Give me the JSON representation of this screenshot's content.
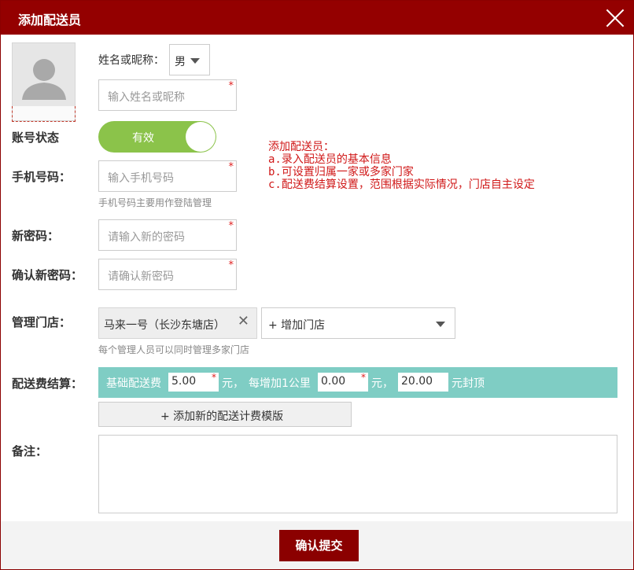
{
  "dialog": {
    "title": "添加配送员"
  },
  "form": {
    "name_label": "姓名或昵称：",
    "gender_value": "男",
    "name_placeholder": "输入姓名或昵称",
    "required_mark": "*",
    "status_label": "账号状态",
    "status_value": "有效",
    "phone_label": "手机号码：",
    "phone_placeholder": "输入手机号码",
    "phone_hint": "手机号码主要用作登陆管理",
    "new_password_label": "新密码：",
    "new_password_placeholder": "请输入新的密码",
    "confirm_password_label": "确认新密码：",
    "confirm_password_placeholder": "请确认新密码",
    "store_label": "管理门店：",
    "store_selected": "马来一号（长沙东塘店）",
    "add_store": "+ 增加门店",
    "store_hint": "每个管理人员可以同时管理多家门店",
    "fee_label": "配送费结算：",
    "fee_base_text": "基础配送费",
    "fee_base_value": "5.00",
    "fee_unit1": "元，",
    "fee_per_km_text": "每增加1公里",
    "fee_per_km_value": "0.00",
    "fee_unit2": "元，",
    "fee_cap_value": "20.00",
    "fee_cap_text": "元封顶",
    "add_template": "+ 添加新的配送计费模版",
    "remark_label": "备注："
  },
  "note": {
    "lines": [
      "添加配送员：",
      "a.录入配送员的基本信息",
      "b.可设置归属一家或多家门家",
      "c.配送费结算设置，范围根据实际情况，门店自主设定"
    ],
    "color": "#d01818"
  },
  "footer": {
    "submit": "确认提交"
  },
  "colors": {
    "title_bar": "#940000",
    "toggle_on": "#8bc34a",
    "fee_bar": "#7fcdc4",
    "submit_button": "#8b0000"
  }
}
